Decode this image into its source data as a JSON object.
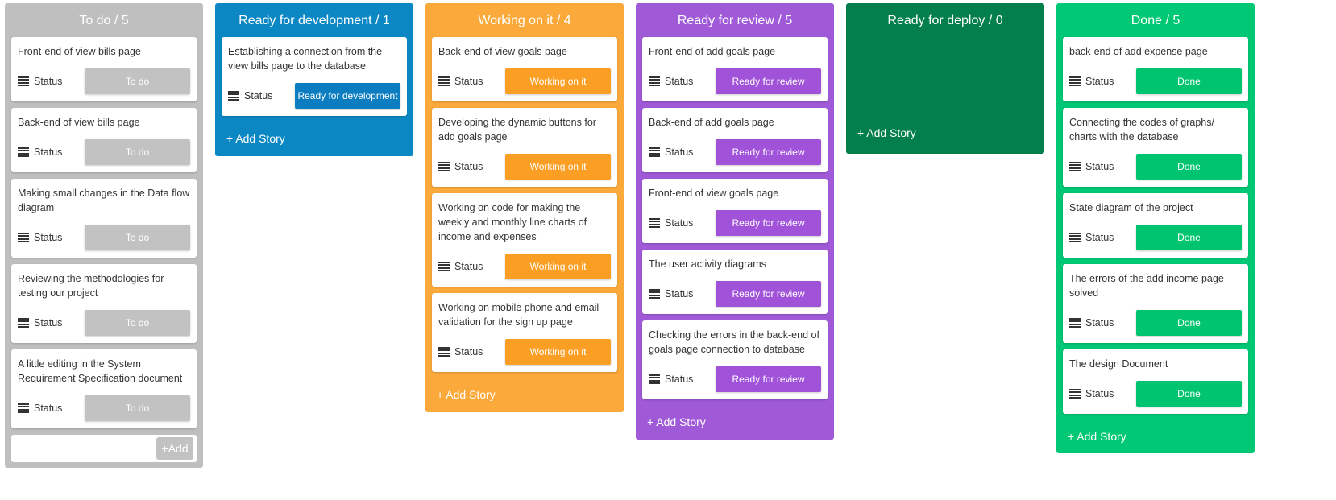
{
  "columns": [
    {
      "title": "To do / 5",
      "color": "#bfbfbf",
      "button_color": "#c2c2c2",
      "cards": [
        {
          "title": "Front-end of view bills page",
          "status_label": "Status",
          "status": "To do"
        },
        {
          "title": "Back-end of view bills page",
          "status_label": "Status",
          "status": "To do"
        },
        {
          "title": "Making small changes in the Data flow diagram",
          "status_label": "Status",
          "status": "To do"
        },
        {
          "title": "Reviewing the methodologies for testing our project",
          "status_label": "Status",
          "status": "To do"
        },
        {
          "title": "A little editing in the System Requirement Specification document",
          "status_label": "Status",
          "status": "To do"
        }
      ],
      "add_button": "+Add"
    },
    {
      "title": "Ready for development / 1",
      "color": "#0b88c4",
      "button_color": "#0b7dc0",
      "cards": [
        {
          "title": "Establishing a connection from the view bills page to the database",
          "status_label": "Status",
          "status": "Ready for development"
        }
      ],
      "add_story": "+ Add Story"
    },
    {
      "title": "Working on it / 4",
      "color": "#fba93b",
      "button_color": "#fb9f24",
      "cards": [
        {
          "title": "Back-end of view goals page",
          "status_label": "Status",
          "status": "Working on it"
        },
        {
          "title": "Developing the dynamic buttons for add goals page",
          "status_label": "Status",
          "status": "Working on it"
        },
        {
          "title": "Working on code for making the weekly and monthly line charts of income and expenses",
          "status_label": "Status",
          "status": "Working on it"
        },
        {
          "title": "Working on mobile phone and email validation for the sign up page",
          "status_label": "Status",
          "status": "Working on it"
        }
      ],
      "add_story": "+ Add Story"
    },
    {
      "title": "Ready for review / 5",
      "color": "#a05ad8",
      "button_color": "#a052d8",
      "cards": [
        {
          "title": "Front-end of add goals page",
          "status_label": "Status",
          "status": "Ready for review"
        },
        {
          "title": "Back-end of add goals page",
          "status_label": "Status",
          "status": "Ready for review"
        },
        {
          "title": "Front-end of view goals page",
          "status_label": "Status",
          "status": "Ready for review"
        },
        {
          "title": "The user activity diagrams",
          "status_label": "Status",
          "status": "Ready for review"
        },
        {
          "title": "Checking the errors in the back-end of goals page connection to database",
          "status_label": "Status",
          "status": "Ready for review"
        }
      ],
      "add_story": "+ Add Story"
    },
    {
      "title": "Ready for deploy / 0",
      "color": "#037f4c",
      "button_color": "#037f4c",
      "cards": [],
      "add_story": "+ Add Story"
    },
    {
      "title": "Done / 5",
      "color": "#00c875",
      "button_color": "#00c46f",
      "cards": [
        {
          "title": "back-end of add expense page",
          "status_label": "Status",
          "status": "Done"
        },
        {
          "title": "Connecting the codes of graphs/ charts with the database",
          "status_label": "Status",
          "status": "Done"
        },
        {
          "title": "State diagram of the project",
          "status_label": "Status",
          "status": "Done"
        },
        {
          "title": "The errors of the add income page solved",
          "status_label": "Status",
          "status": "Done"
        },
        {
          "title": "The design Document",
          "status_label": "Status",
          "status": "Done"
        }
      ],
      "add_story": "+ Add Story"
    }
  ]
}
